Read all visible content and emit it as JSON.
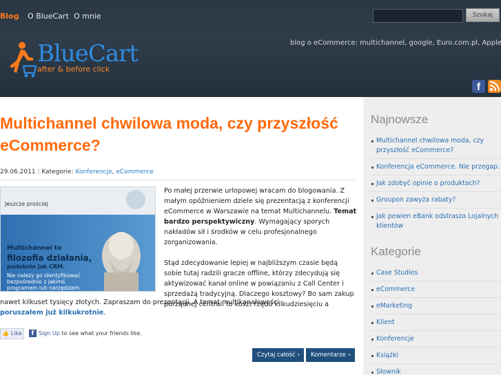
{
  "nav": {
    "items": [
      "Blog",
      "O BlueCart",
      "O mnie"
    ]
  },
  "search": {
    "placeholder": "",
    "button_label": "Szukaj"
  },
  "brand": {
    "name": "BlueCart",
    "slogan": "after & before click"
  },
  "tagline": "blog o eCommerce: multichannel, google, Euro.com.pl, Apple ...",
  "social": {
    "facebook_glyph": "f"
  },
  "post": {
    "title": "Multichannel chwilowa moda, czy przyszłość eCommerce?",
    "date": "29.06.2011",
    "categories_label": "Kategorie:",
    "categories": [
      "Konferencje",
      "eCommerce"
    ],
    "image": {
      "line1": "Jeszcze prościej",
      "line2": "Multichannel to",
      "line3": "filozofia działania,",
      "line4": "podobnie jak CRM.",
      "line5": "Nie należy go identyfikować",
      "line6": "bezpośrednio z jakimś",
      "line7": "programem lub narzędziem"
    },
    "p1_a": "Po małej przerwie urlopowej wracam do blogowania. Z małym opóźnieniem dziele się prezentacją z konferencji eCommerce w Warszawie na temat Multichannelu. ",
    "p1_bold": "Temat bardzo perspektywiczny",
    "p1_b": ". Wymagający sporych nakładów sił i środków w celu profesjonalnego zorganizowania.",
    "p2_a": "Stąd zdecydowanie lepiej w najbliższym czasie będą sobie tutaj radzili gracze offline, którzy zdecydują się aktywizować kanał online w powiązaniu z Call Center i sprzedażą tradycyjną. Dlaczego kosztowy? Bo sam zakup porządnej centrali to koszt rzędu kilkudziesięciu a",
    "p2_b": "nawet kilkuset tysięcy złotych. Zapraszam do prezentacji. A temat multikanałowości",
    "p2_link": "poruszałem już kilkukrotnie",
    "p2_end": ".",
    "like_label": "Like",
    "signup_link": "Sign Up",
    "signup_rest": " to see what your friends like.",
    "read_more": "Czytaj całość",
    "comments": "Komentarze",
    "arrow": "›"
  },
  "sidebar": {
    "latest_title": "Najnowsze",
    "latest": [
      "Multichannel chwilowa moda, czy przyszłość eCommerce?",
      "Konferencja eCommerce. Nie przegap.",
      "Jak zdobyć opinie o produktach?",
      "Groupon zawyża rabaty?",
      "Jak pewien eBank odstrasza Lojalnych klientów"
    ],
    "categories_title": "Kategorie",
    "categories": [
      "Case Studies",
      "eCommerce",
      "eMarketing",
      "Klient",
      "Konferencje",
      "Książki",
      "Słownik"
    ]
  },
  "colors": {
    "accent": "#ff6a0d",
    "link": "#2a6fb3",
    "header_bg": "#2b3744",
    "button_bg": "#1f4f7c"
  }
}
